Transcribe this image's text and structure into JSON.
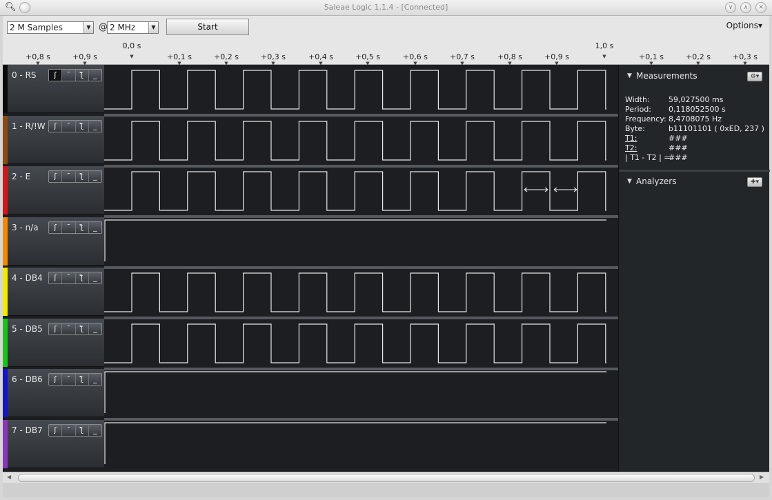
{
  "window": {
    "title": "Saleae Logic 1.1.4 - [Connected]"
  },
  "toolbar": {
    "samples": "2 M Samples",
    "at": "@",
    "rate": "2 MHz",
    "start": "Start",
    "options": "Options▾"
  },
  "ruler": {
    "major_left": "0,0 s",
    "major_right": "1,0 s",
    "ticks": [
      "+0,8 s",
      "+0,9 s",
      "+0,1 s",
      "+0,2 s",
      "+0,3 s",
      "+0,4 s",
      "+0,5 s",
      "+0,6 s",
      "+0,7 s",
      "+0,8 s",
      "+0,9 s",
      "+0,1 s",
      "+0,2 s",
      "+0,3 s"
    ]
  },
  "channels": [
    {
      "name": "0 - RS",
      "color": "#0a0a0a",
      "wave": "clock"
    },
    {
      "name": "1 - R/!W",
      "color": "#8a4b12",
      "wave": "clock"
    },
    {
      "name": "2 - E",
      "color": "#d21717",
      "wave": "clock"
    },
    {
      "name": "3 - n/a",
      "color": "#f28a00",
      "wave": "high"
    },
    {
      "name": "4 - DB4",
      "color": "#f2ea00",
      "wave": "clock"
    },
    {
      "name": "5 - DB5",
      "color": "#1cc21c",
      "wave": "clock"
    },
    {
      "name": "6 - DB6",
      "color": "#1414c8",
      "wave": "high"
    },
    {
      "name": "7 - DB7",
      "color": "#8a36b8",
      "wave": "high"
    }
  ],
  "trigger_icons": [
    "rising-edge-icon",
    "high-level-icon",
    "falling-edge-icon",
    "low-level-icon"
  ],
  "measurements": {
    "title": "Measurements",
    "rows": [
      {
        "k": "Width:",
        "v": "59,027500 ms"
      },
      {
        "k": "Period:",
        "v": "0,118052500 s"
      },
      {
        "k": "Frequency:",
        "v": "8,4708075 Hz"
      },
      {
        "k": "Byte:",
        "v": "b11101101 ( 0xED, 237 )"
      },
      {
        "k": "T1:",
        "v": "###"
      },
      {
        "k": "T2:",
        "v": "###"
      },
      {
        "k": "| T1 - T2 | =",
        "v": "###"
      }
    ]
  },
  "analyzers": {
    "title": "Analyzers"
  }
}
